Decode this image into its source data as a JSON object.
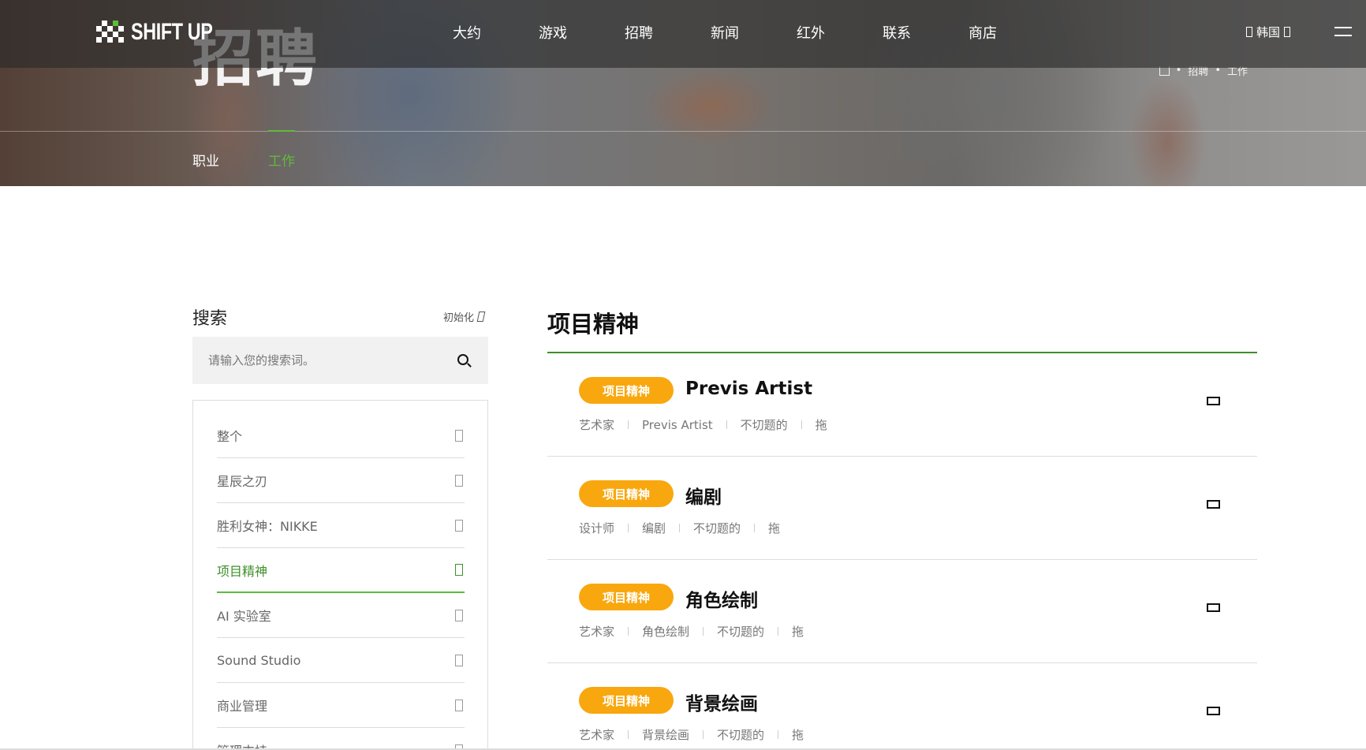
{
  "brand": {
    "logo_text": "SHIFT UP",
    "accent": "#5fbb3c",
    "tag_color": "#f9a70e"
  },
  "nav": {
    "items": [
      "大约",
      "游戏",
      "招聘",
      "新闻",
      "红外",
      "联系",
      "商店"
    ],
    "language": "韩国"
  },
  "hero": {
    "title": "招聘",
    "breadcrumb": [
      "招聘",
      "工作"
    ],
    "tabs": [
      "职业",
      "工作"
    ],
    "active_tab": "工作"
  },
  "sidebar": {
    "title": "搜索",
    "reset_label": "初始化",
    "search_placeholder": "请输入您的搜索词。",
    "categories": [
      "整个",
      "星辰之刃",
      "胜利女神：NIKKE",
      "项目精神",
      "AI 实验室",
      "Sound Studio",
      "商业管理",
      "管理支持"
    ],
    "active_category": "项目精神"
  },
  "main": {
    "title": "项目精神",
    "jobs": [
      {
        "tag": "项目精神",
        "title": "Previs Artist",
        "meta": [
          "艺术家",
          "Previs Artist",
          "不切题的",
          "拖"
        ]
      },
      {
        "tag": "项目精神",
        "title": "编剧",
        "meta": [
          "设计师",
          "编剧",
          "不切题的",
          "拖"
        ]
      },
      {
        "tag": "项目精神",
        "title": "角色绘制",
        "meta": [
          "艺术家",
          "角色绘制",
          "不切题的",
          "拖"
        ]
      },
      {
        "tag": "项目精神",
        "title": "背景绘画",
        "meta": [
          "艺术家",
          "背景绘画",
          "不切题的",
          "拖"
        ]
      }
    ]
  }
}
